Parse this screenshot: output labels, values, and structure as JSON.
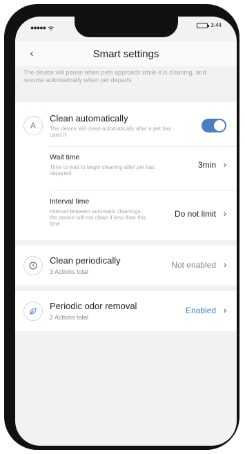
{
  "status_bar": {
    "signal": "●●●●●",
    "wifi": "ᯤ",
    "time": "3:44"
  },
  "nav": {
    "back_icon": "‹",
    "title": "Smart settings"
  },
  "intro_text": "The device will pause when pets approach while it is cleaning, and resume automatically when pet departs",
  "auto_clean": {
    "icon_letter": "A",
    "title": "Clean automatically",
    "description": "The device will clean automatically after a pet has used it",
    "enabled": true,
    "wait_time": {
      "title": "Wait time",
      "description": "Time to wait to begin cleaning after pet has departed",
      "value": "3min"
    },
    "interval_time": {
      "title": "Interval time",
      "description": "Interval between automatic cleanings, the device will not clean if less than this time",
      "value": "Do not limit"
    }
  },
  "periodic_clean": {
    "title": "Clean periodically",
    "subtitle": "3 Actions total",
    "value": "Not enabled"
  },
  "odor_removal": {
    "title": "Periodic odor removal",
    "subtitle": "2 Actions total",
    "value": "Enabled"
  },
  "colors": {
    "accent": "#4a7fc1",
    "background": "#f2f2f4",
    "muted_text": "#a8a8ad"
  }
}
